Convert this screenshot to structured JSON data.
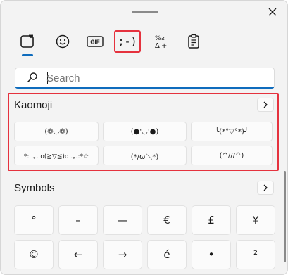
{
  "search": {
    "placeholder": "Search"
  },
  "tabs": [
    {
      "name": "emoji-tab",
      "icon": "emoji-heart-icon"
    },
    {
      "name": "smiley-tab",
      "icon": "smiley-face-icon"
    },
    {
      "name": "gif-tab",
      "label": "GIF"
    },
    {
      "name": "kaomoji-tab",
      "label": ";-)"
    },
    {
      "name": "symbols-tab",
      "icon": "symbols-icon"
    },
    {
      "name": "clipboard-tab",
      "icon": "clipboard-icon"
    }
  ],
  "kaomoji": {
    "title": "Kaomoji",
    "items": [
      "(❁◡❁)",
      "(●'◡'●)",
      "╰(*°▽°*)╯",
      "*: .｡. o(≧▽≦)o .｡.:*☆",
      "(*/ω＼*)",
      "(^///^)"
    ]
  },
  "symbols": {
    "title": "Symbols",
    "items": [
      "°",
      "–",
      "—",
      "€",
      "£",
      "¥",
      "©",
      "←",
      "→",
      "é",
      "•",
      "²"
    ]
  },
  "colors": {
    "accent": "#0f6cbd",
    "highlight": "#e5323e"
  }
}
